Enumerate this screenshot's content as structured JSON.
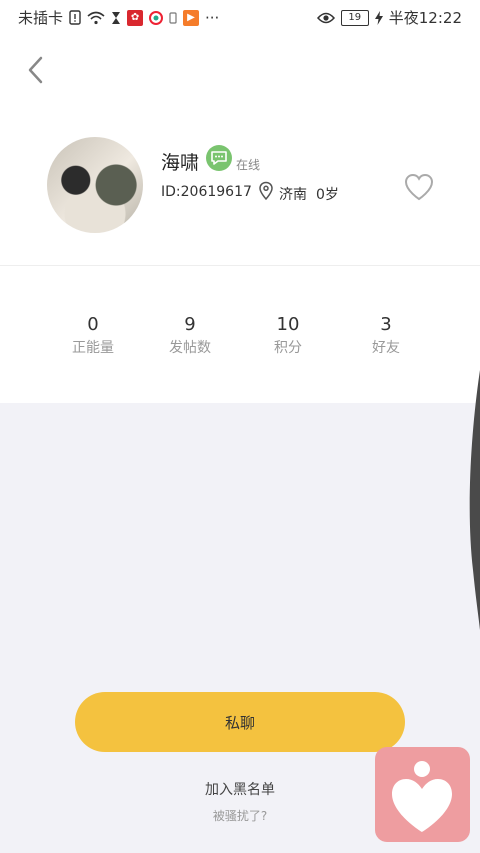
{
  "status_bar": {
    "carrier": "未插卡",
    "time_prefix": "半夜",
    "time": "12:22",
    "battery_level": "19",
    "more_dots": "···"
  },
  "profile": {
    "name": "海啸",
    "online_status": "在线",
    "user_id": "ID:20619617",
    "city": "济南",
    "age": "0岁"
  },
  "stats": [
    {
      "value": "0",
      "label": "正能量"
    },
    {
      "value": "9",
      "label": "发帖数"
    },
    {
      "value": "10",
      "label": "积分"
    },
    {
      "value": "3",
      "label": "好友"
    }
  ],
  "actions": {
    "chat_label": "私聊",
    "blacklist_label": "加入黑名单",
    "harassed_label": "被骚扰了?"
  },
  "colors": {
    "accent": "#f4c23f",
    "online_badge": "#7ac46f",
    "floating_button": "#ee9da0",
    "background": "#f2f2f7"
  }
}
